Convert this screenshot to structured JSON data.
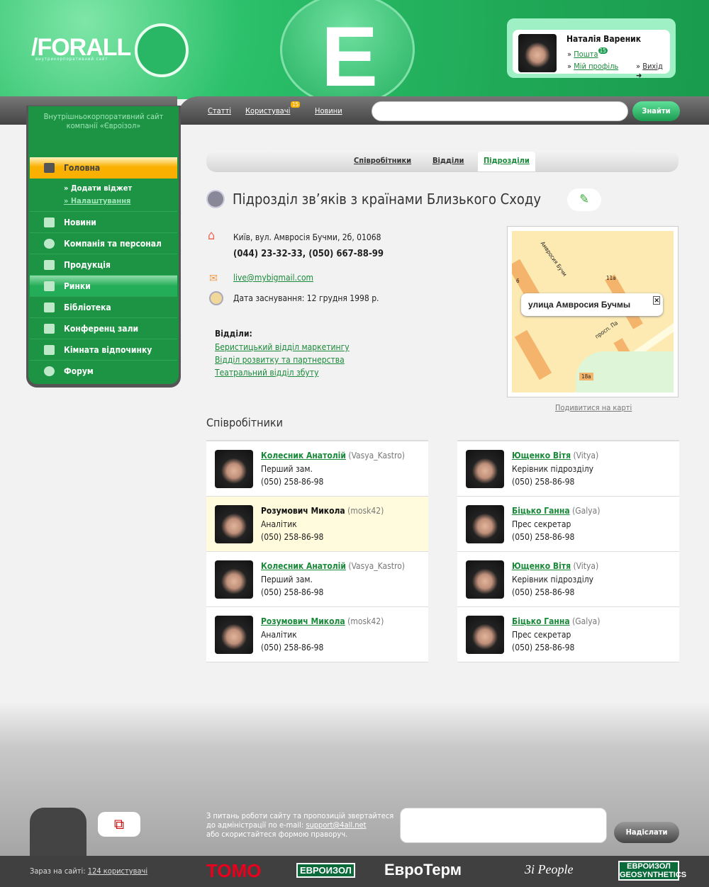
{
  "header": {
    "logo": "/FORALL",
    "logo_sub": "внутрикорпоративний сайт",
    "letter": "E"
  },
  "user": {
    "name": "Наталія Вареник",
    "mail": "Пошта",
    "mail_badge": "15",
    "profile": "Мій профіль",
    "logout": "Вихід"
  },
  "nav": {
    "items": [
      {
        "label": "Статті"
      },
      {
        "label": "Користувачі",
        "badge": "15"
      },
      {
        "label": "Новини"
      }
    ],
    "search_placeholder": "",
    "search_button": "Знайти"
  },
  "sidebar": {
    "tagline": "Внутрішньокорпоративний сайт компанії «Євроізол»",
    "items": [
      {
        "label": "Головна",
        "icon": "home-icon"
      },
      {
        "label": "Новини",
        "icon": "rss-icon"
      },
      {
        "label": "Компанія та персонал",
        "icon": "company-icon"
      },
      {
        "label": "Продукція",
        "icon": "grid-icon"
      },
      {
        "label": "Ринки",
        "icon": "chart-icon"
      },
      {
        "label": "Бібліотека",
        "icon": "book-icon"
      },
      {
        "label": "Конференц зали",
        "icon": "users-icon"
      },
      {
        "label": "Кімната відпочинку",
        "icon": "coffee-icon"
      },
      {
        "label": "Форум",
        "icon": "chat-icon"
      }
    ],
    "subitems": [
      {
        "label": "» Додати віджет"
      },
      {
        "label": "» Налаштування"
      }
    ]
  },
  "tabs": [
    {
      "label": "Співробітники"
    },
    {
      "label": "Відділи"
    },
    {
      "label": "Підрозділи",
      "active": true
    }
  ],
  "unit": {
    "title": "Підрозділ зв’яків з країнами Близького Сходу",
    "address": "Київ, вул. Амвросія Бучми, 2б, 01068",
    "phones": "(044) 23-32-33, (050) 667-88-99",
    "email": "live@mybigmail.com",
    "founded": "Дата заснування: 12 грудня 1998 р.",
    "departments_label": "Відділи:",
    "departments": [
      "Беристицький відділ маркетингу",
      "Відділ розвитку та партнерства",
      "Театральний відділ збуту"
    ]
  },
  "map": {
    "popup": "улица Амвросия Бучмы",
    "labels": [
      "Амвросия Бучм",
      "11а",
      "6",
      "просп. Па",
      "18а"
    ],
    "link": "Подивитися на карті"
  },
  "employees_title": "Співробітники",
  "employees": [
    {
      "name": "Колесник Анатолій",
      "login": "(Vasya_Kastro)",
      "role": "Перший зам.",
      "phone": "(050) 258-86-98"
    },
    {
      "name": "Ющенко Вітя",
      "login": "(Vitya)",
      "role": "Керівник підрозділу",
      "phone": "(050) 258-86-98"
    },
    {
      "name": "Розумович Микола",
      "login": "(mosk42)",
      "role": "Аналітик",
      "phone": "(050) 258-86-98",
      "hover": true
    },
    {
      "name": "Біцько Ганна",
      "login": "(Galya)",
      "role": "Прес секретар",
      "phone": "(050) 258-86-98"
    },
    {
      "name": "Колесник Анатолій",
      "login": "(Vasya_Kastro)",
      "role": "Перший зам.",
      "phone": "(050) 258-86-98"
    },
    {
      "name": "Ющенко Вітя",
      "login": "(Vitya)",
      "role": "Керівник підрозділу",
      "phone": "(050) 258-86-98"
    },
    {
      "name": "Розумович Микола",
      "login": "(mosk42)",
      "role": "Аналітик",
      "phone": "(050) 258-86-98"
    },
    {
      "name": "Біцько Ганна",
      "login": "(Galya)",
      "role": "Прес секретар",
      "phone": "(050) 258-86-98"
    }
  ],
  "footer": {
    "contact_1": "З питань роботи сайту та пропозицій звертайтеся",
    "contact_2": "до адміністрації по e-mail:",
    "contact_email": "support@4all.net",
    "contact_3": "або скористайтеся формою праворуч.",
    "send": "Надіслати",
    "online_label": "Зараз на сайті:",
    "online_count": "124 користувачі",
    "partners": [
      "TOMO",
      "ЕВРОИЗОЛ",
      "ЕвроТерм",
      "3i People",
      "ЕВРОИЗОЛ GEOSYNTHETICS"
    ]
  },
  "colors": {
    "green": "#1d9444",
    "accent": "#f9b000",
    "link": "#1a8a3a"
  }
}
